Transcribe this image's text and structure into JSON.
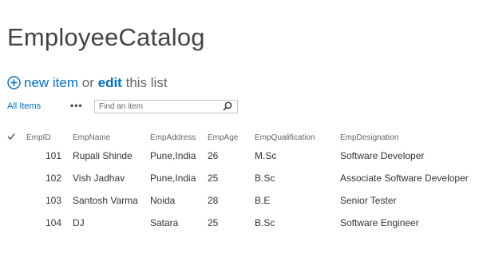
{
  "page_title": "EmployeeCatalog",
  "new_item": {
    "new_label": "new item",
    "or_label": "or",
    "edit_label": "edit",
    "list_label": "this list"
  },
  "view": {
    "all_items_label": "All Items",
    "more_label": "•••",
    "search_placeholder": "Find an item"
  },
  "table": {
    "columns": [
      "EmpID",
      "EmpName",
      "EmpAddress",
      "EmpAge",
      "EmpQualification",
      "EmpDesignation"
    ],
    "rows": [
      {
        "id": "101",
        "name": "Rupali Shinde",
        "address": "Pune,India",
        "age": "26",
        "qualification": "M.Sc",
        "designation": "Software Developer"
      },
      {
        "id": "102",
        "name": "Vish Jadhav",
        "address": "Pune,India",
        "age": "25",
        "qualification": "B.Sc",
        "designation": "Associate Software Developer"
      },
      {
        "id": "103",
        "name": "Santosh Varma",
        "address": "Noida",
        "age": "28",
        "qualification": "B.E",
        "designation": "Senior Tester"
      },
      {
        "id": "104",
        "name": "DJ",
        "address": "Satara",
        "age": "25",
        "qualification": "B.Sc",
        "designation": "Software Engineer"
      }
    ]
  },
  "colors": {
    "link": "#0072c6",
    "text": "#444444"
  },
  "icons": {
    "add": "plus-circle-icon",
    "search": "search-icon",
    "select_all": "checkmark-icon"
  }
}
